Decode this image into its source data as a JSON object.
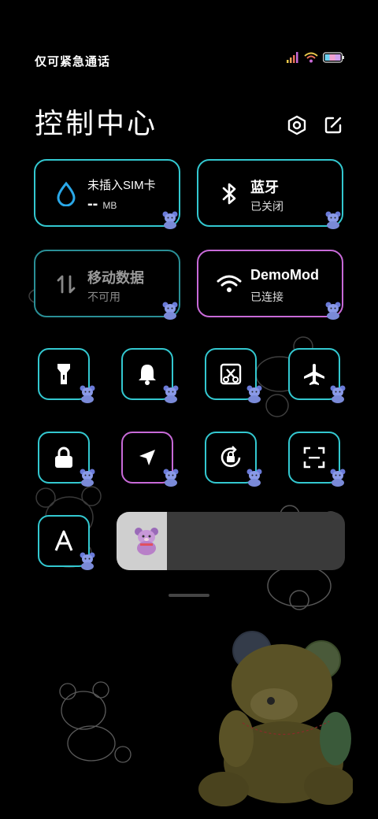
{
  "status": {
    "carrier": "仅可紧急通话"
  },
  "header": {
    "title": "控制中心"
  },
  "cards": {
    "sim": {
      "title": "未插入SIM卡",
      "value": "-- ",
      "unit": "MB"
    },
    "bluetooth": {
      "title": "蓝牙",
      "status": "已关闭"
    },
    "mobile_data": {
      "title": "移动数据",
      "status": "不可用"
    },
    "wifi": {
      "title": "DemoMod",
      "status": "已连接"
    }
  },
  "brightness": {
    "level": 0.22
  },
  "colors": {
    "accent_cyan": "#33c8d0",
    "accent_pink": "#c86ad8",
    "water_blue": "#2aa8e8"
  },
  "tiles": [
    {
      "icon": "flashlight-icon"
    },
    {
      "icon": "bell-icon"
    },
    {
      "icon": "screenshot-icon"
    },
    {
      "icon": "airplane-icon"
    },
    {
      "icon": "lock-icon"
    },
    {
      "icon": "location-icon"
    },
    {
      "icon": "rotation-lock-icon"
    },
    {
      "icon": "scan-icon"
    },
    {
      "icon": "font-icon"
    }
  ]
}
